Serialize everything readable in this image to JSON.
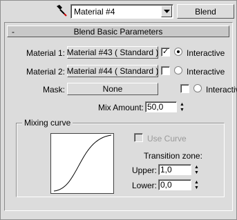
{
  "top": {
    "material_name": "Material #4",
    "type_button": "Blend"
  },
  "rollout": {
    "title": "Blend Basic Parameters",
    "collapse_symbol": "-"
  },
  "materials": {
    "material1_label": "Material 1:",
    "material1_value": "Material #43  ( Standard )",
    "material1_checked": true,
    "material1_interactive_selected": true,
    "material2_label": "Material 2:",
    "material2_value": "Material #44  ( Standard )",
    "material2_checked": false,
    "mask_label": "Mask:",
    "mask_value": "None",
    "mask_checked": false,
    "interactive_label": "Interactive"
  },
  "mix": {
    "label": "Mix Amount:",
    "value": "50,0"
  },
  "mixing_curve": {
    "title": "Mixing curve",
    "use_curve_label": "Use Curve",
    "use_curve_checked": false,
    "transition_label": "Transition zone:",
    "upper_label": "Upper:",
    "upper_value": "1,0",
    "lower_label": "Lower:",
    "lower_value": "0,0"
  }
}
